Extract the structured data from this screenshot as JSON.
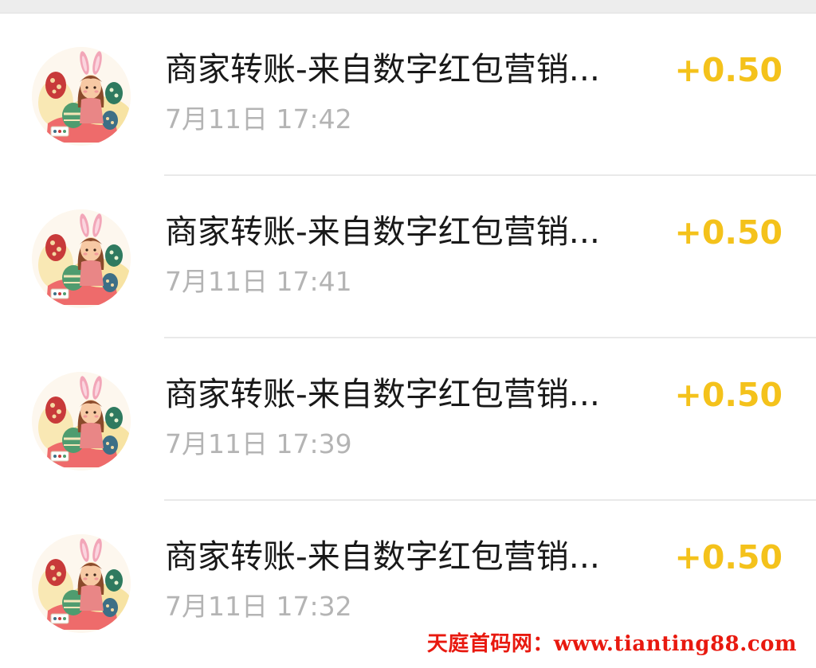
{
  "transactions": [
    {
      "title": "商家转账-来自数字红包营销...",
      "time": "7月11日 17:42",
      "amount": "+0.50",
      "avatar_icon": "easter-girl-avatar-icon"
    },
    {
      "title": "商家转账-来自数字红包营销...",
      "time": "7月11日 17:41",
      "amount": "+0.50",
      "avatar_icon": "easter-girl-avatar-icon"
    },
    {
      "title": "商家转账-来自数字红包营销...",
      "time": "7月11日 17:39",
      "amount": "+0.50",
      "avatar_icon": "easter-girl-avatar-icon"
    },
    {
      "title": "商家转账-来自数字红包营销...",
      "time": "7月11日 17:32",
      "amount": "+0.50",
      "avatar_icon": "easter-girl-avatar-icon"
    }
  ],
  "watermark": "天庭首码网：www.tianting88.com",
  "colors": {
    "amount": "#f4c21b",
    "title": "#191919",
    "time": "#b4b4b4",
    "watermark": "#e8190f"
  }
}
